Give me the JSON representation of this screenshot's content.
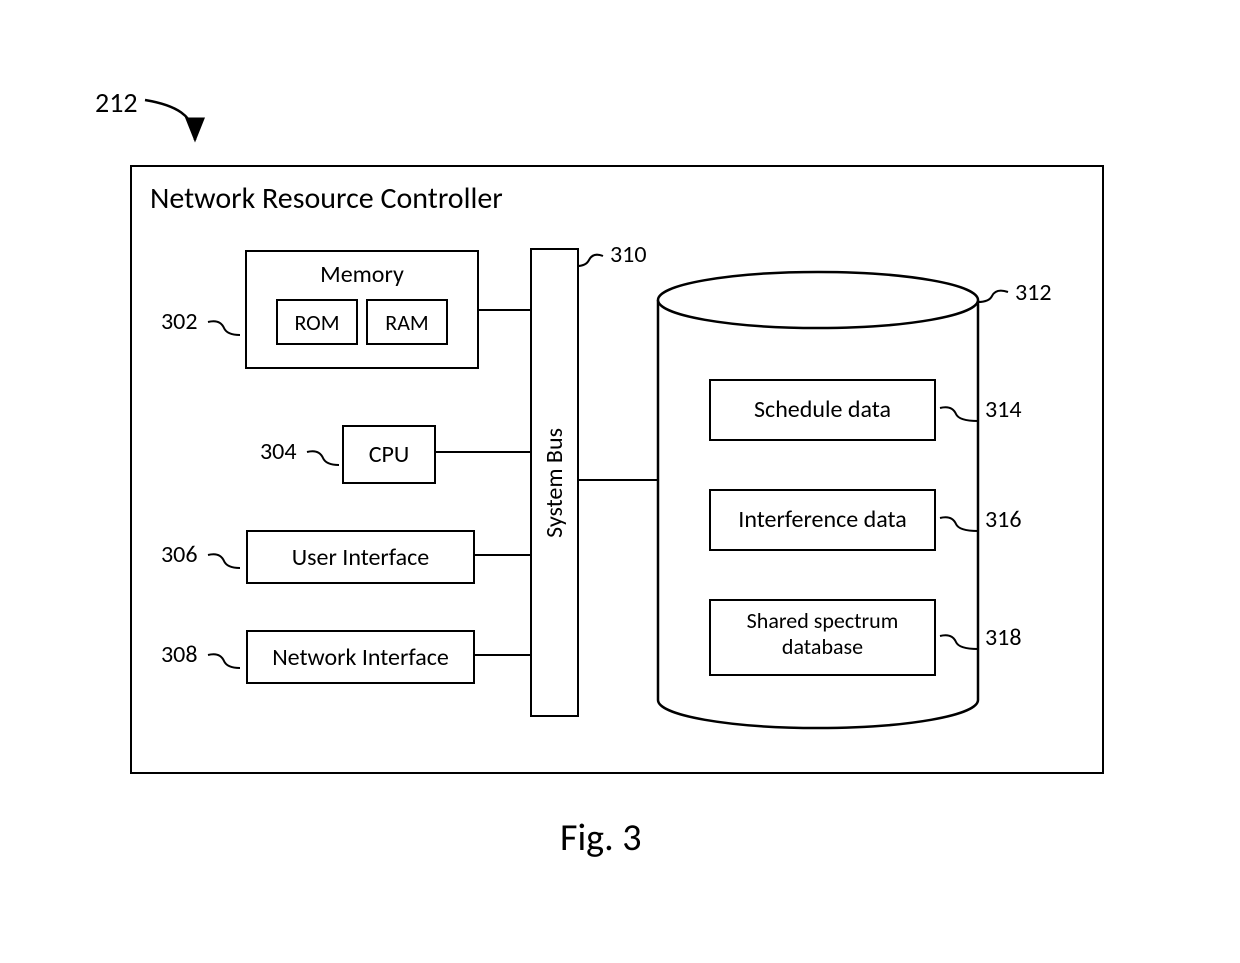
{
  "figure_ref": "212",
  "title": "Network Resource Controller",
  "figure_caption": "Fig. 3",
  "memory": {
    "label": "Memory",
    "rom": "ROM",
    "ram": "RAM",
    "ref": "302"
  },
  "cpu": {
    "label": "CPU",
    "ref": "304"
  },
  "ui": {
    "label": "User Interface",
    "ref": "306"
  },
  "net": {
    "label": "Network Interface",
    "ref": "308"
  },
  "bus": {
    "label": "System Bus",
    "ref": "310"
  },
  "db": {
    "ref": "312",
    "schedule": {
      "label": "Schedule data",
      "ref": "314"
    },
    "interference": {
      "label": "Interference data",
      "ref": "316"
    },
    "spectrum": {
      "label": "Shared spectrum database",
      "ref": "318"
    }
  }
}
